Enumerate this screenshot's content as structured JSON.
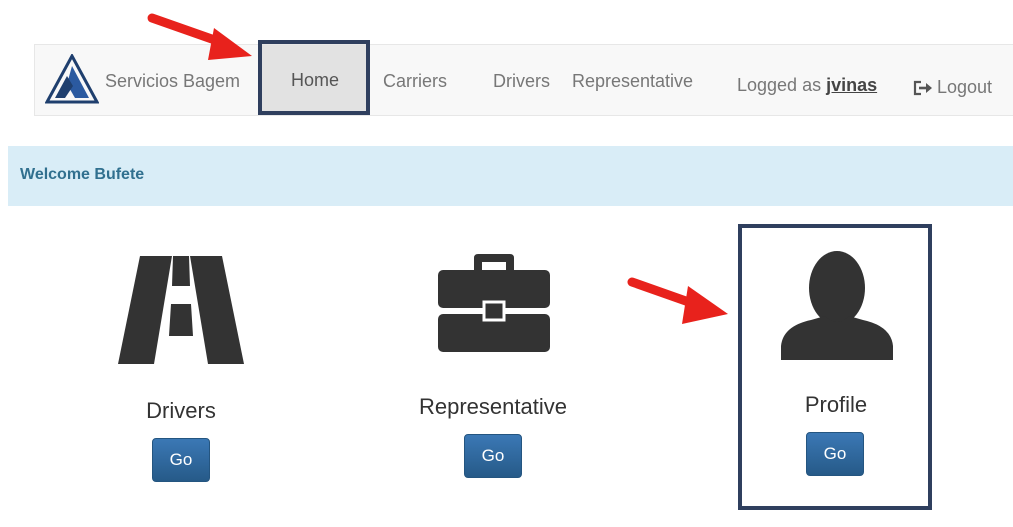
{
  "navbar": {
    "brand": "Servicios Bagem",
    "links": [
      "Home",
      "Carriers",
      "Drivers",
      "Representative"
    ],
    "logged_prefix": "Logged as",
    "username": "jvinas",
    "logout": "Logout"
  },
  "welcome": "Welcome Bufete",
  "tiles": [
    {
      "label": "Drivers",
      "button": "Go",
      "icon": "road-icon"
    },
    {
      "label": "Representative",
      "button": "Go",
      "icon": "briefcase-icon"
    },
    {
      "label": "Profile",
      "button": "Go",
      "icon": "user-icon"
    }
  ],
  "colors": {
    "accent": "#2f6aa6",
    "welcome_bg": "#d9edf7",
    "highlight": "#2f3f5e",
    "annotation_arrow": "#e8221c"
  }
}
